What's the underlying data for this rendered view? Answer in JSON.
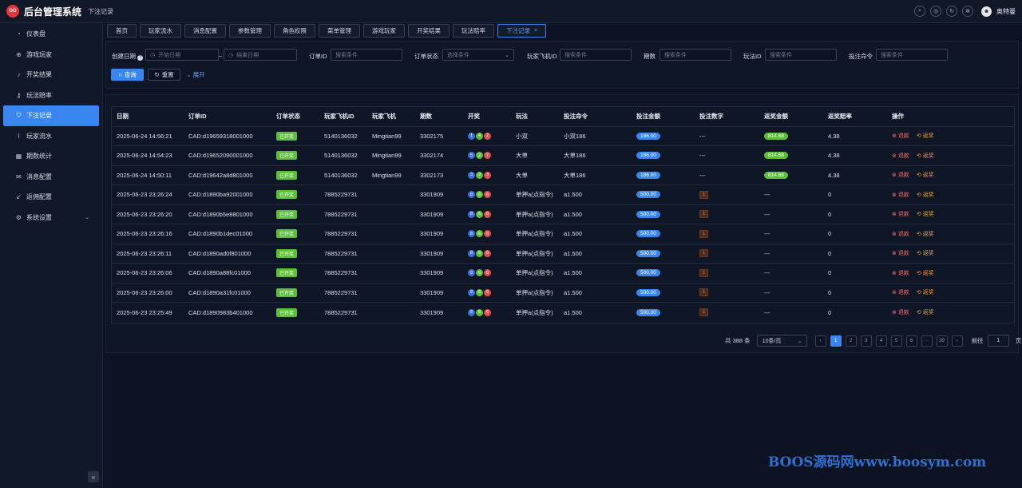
{
  "header": {
    "logo_text": "GO",
    "app_title": "后台管理系统",
    "breadcrumb": "下注记录",
    "username": "奥特曼"
  },
  "sidebar": {
    "items": [
      {
        "label": "仪表盘",
        "icon": "dashboard-icon"
      },
      {
        "label": "游戏玩家",
        "icon": "globe-icon"
      },
      {
        "label": "开奖结果",
        "icon": "bell-icon"
      },
      {
        "label": "玩法赔率",
        "icon": "key-icon"
      },
      {
        "label": "下注记录",
        "icon": "shield-icon",
        "active": true
      },
      {
        "label": "玩家流水",
        "icon": "trend-icon"
      },
      {
        "label": "期数统计",
        "icon": "calendar-icon"
      },
      {
        "label": "消息配置",
        "icon": "message-icon"
      },
      {
        "label": "返佣配置",
        "icon": "arrow-icon"
      },
      {
        "label": "系统设置",
        "icon": "settings-icon",
        "has_children": true
      }
    ],
    "collapse_label": "«"
  },
  "tabs": [
    {
      "label": "首页"
    },
    {
      "label": "玩家流水"
    },
    {
      "label": "消息配置"
    },
    {
      "label": "参数管理"
    },
    {
      "label": "角色权限"
    },
    {
      "label": "菜单管理"
    },
    {
      "label": "游戏玩家"
    },
    {
      "label": "开奖结果"
    },
    {
      "label": "玩法赔率"
    },
    {
      "label": "下注记录",
      "active": true,
      "close": "×"
    }
  ],
  "filters": {
    "create_date_label": "创建日期",
    "start_date_placeholder": "开始日期",
    "date_sep": "–",
    "end_date_placeholder": "结束日期",
    "order_id_label": "订单ID",
    "order_id_placeholder": "搜索条件",
    "order_status_label": "订单状态",
    "order_status_placeholder": "选择条件",
    "player_fid_label": "玩家飞机ID",
    "player_fid_placeholder": "搜索条件",
    "period_label": "期数",
    "period_placeholder": "搜索条件",
    "play_id_label": "玩法ID",
    "play_id_placeholder": "搜索条件",
    "bet_cmd_label": "投注命令",
    "bet_cmd_placeholder": "搜索条件",
    "search_btn": "查询",
    "reset_btn": "重置",
    "expand_btn": "展开"
  },
  "table": {
    "columns": [
      "日期",
      "订单ID",
      "订单状态",
      "玩家飞机ID",
      "玩家飞机",
      "期数",
      "开奖",
      "玩法",
      "投注命令",
      "投注金额",
      "投注数字",
      "返奖金额",
      "返奖赔率",
      "操作"
    ],
    "rows": [
      {
        "date": "2025-06-24 14:56:21",
        "order_id": "CAD:d19659318001000",
        "status": "已开奖",
        "fid": "5140136032",
        "fname": "Mingtian99",
        "period": "3302175",
        "balls": [
          {
            "n": "1",
            "c": "#3a6fe0"
          },
          {
            "n": "4",
            "c": "#5cbf3a"
          },
          {
            "n": "2",
            "c": "#e05050"
          }
        ],
        "play": "小双",
        "cmd": "小双186",
        "amount": "186.00",
        "digit": "---",
        "reward": "814.68",
        "odds": "4.38",
        "op_refund": "退款",
        "op_reward": "返奖"
      },
      {
        "date": "2025-06-24 14:54:23",
        "order_id": "CAD:d19652090001000",
        "status": "已开奖",
        "fid": "5140136032",
        "fname": "Mingtian99",
        "period": "3302174",
        "balls": [
          {
            "n": "5",
            "c": "#3a6fe0"
          },
          {
            "n": "2",
            "c": "#5cbf3a"
          },
          {
            "n": "7",
            "c": "#e05050"
          }
        ],
        "play": "大单",
        "cmd": "大单186",
        "amount": "186.00",
        "digit": "---",
        "reward": "814.68",
        "odds": "4.38",
        "op_refund": "退款",
        "op_reward": "返奖"
      },
      {
        "date": "2025-06-24 14:50:11",
        "order_id": "CAD:d19642a8d801000",
        "status": "已开奖",
        "fid": "5140136032",
        "fname": "Mingtian99",
        "period": "3302173",
        "balls": [
          {
            "n": "3",
            "c": "#3a6fe0"
          },
          {
            "n": "9",
            "c": "#5cbf3a"
          },
          {
            "n": "3",
            "c": "#e05050"
          }
        ],
        "play": "大单",
        "cmd": "大单186",
        "amount": "186.00",
        "digit": "---",
        "reward": "814.68",
        "odds": "4.38",
        "op_refund": "退款",
        "op_reward": "返奖"
      },
      {
        "date": "2025-06-23 23:26:24",
        "order_id": "CAD:d1890ba92001000",
        "status": "已开奖",
        "fid": "7885229731",
        "fname": "",
        "period": "3301909",
        "balls": [
          {
            "n": "8",
            "c": "#3a6fe0"
          },
          {
            "n": "6",
            "c": "#5cbf3a"
          },
          {
            "n": "6",
            "c": "#e05050"
          }
        ],
        "play": "单押a(点指令)",
        "cmd": "a1.500",
        "amount": "500.00",
        "digit": "1",
        "reward": "---",
        "odds": "0",
        "op_refund": "退款",
        "op_reward": "返奖"
      },
      {
        "date": "2025-06-23 23:26:20",
        "order_id": "CAD:d1890b5e8801000",
        "status": "已开奖",
        "fid": "7885229731",
        "fname": "",
        "period": "3301909",
        "balls": [
          {
            "n": "8",
            "c": "#3a6fe0"
          },
          {
            "n": "6",
            "c": "#5cbf3a"
          },
          {
            "n": "6",
            "c": "#e05050"
          }
        ],
        "play": "单押a(点指令)",
        "cmd": "a1.500",
        "amount": "500.00",
        "digit": "1",
        "reward": "---",
        "odds": "0",
        "op_refund": "退款",
        "op_reward": "返奖"
      },
      {
        "date": "2025-06-23 23:26:16",
        "order_id": "CAD:d1890b1dec01000",
        "status": "已开奖",
        "fid": "7885229731",
        "fname": "",
        "period": "3301909",
        "balls": [
          {
            "n": "8",
            "c": "#3a6fe0"
          },
          {
            "n": "6",
            "c": "#5cbf3a"
          },
          {
            "n": "6",
            "c": "#e05050"
          }
        ],
        "play": "单押a(点指令)",
        "cmd": "a1.500",
        "amount": "500.00",
        "digit": "1",
        "reward": "---",
        "odds": "0",
        "op_refund": "退款",
        "op_reward": "返奖"
      },
      {
        "date": "2025-06-23 23:26:11",
        "order_id": "CAD:d1890ad0f801000",
        "status": "已开奖",
        "fid": "7885229731",
        "fname": "",
        "period": "3301909",
        "balls": [
          {
            "n": "8",
            "c": "#3a6fe0"
          },
          {
            "n": "6",
            "c": "#5cbf3a"
          },
          {
            "n": "6",
            "c": "#e05050"
          }
        ],
        "play": "单押a(点指令)",
        "cmd": "a1.500",
        "amount": "500.00",
        "digit": "1",
        "reward": "---",
        "odds": "0",
        "op_refund": "退款",
        "op_reward": "返奖"
      },
      {
        "date": "2025-06-23 23:26:06",
        "order_id": "CAD:d1890a88fc01000",
        "status": "已开奖",
        "fid": "7885229731",
        "fname": "",
        "period": "3301909",
        "balls": [
          {
            "n": "8",
            "c": "#3a6fe0"
          },
          {
            "n": "6",
            "c": "#5cbf3a"
          },
          {
            "n": "6",
            "c": "#e05050"
          }
        ],
        "play": "单押a(点指令)",
        "cmd": "a1.500",
        "amount": "500.00",
        "digit": "1",
        "reward": "---",
        "odds": "0",
        "op_refund": "退款",
        "op_reward": "返奖"
      },
      {
        "date": "2025-06-23 23:26:00",
        "order_id": "CAD:d1890a31fc01000",
        "status": "已开奖",
        "fid": "7885229731",
        "fname": "",
        "period": "3301909",
        "balls": [
          {
            "n": "8",
            "c": "#3a6fe0"
          },
          {
            "n": "6",
            "c": "#5cbf3a"
          },
          {
            "n": "6",
            "c": "#e05050"
          }
        ],
        "play": "单押a(点指令)",
        "cmd": "a1.500",
        "amount": "500.00",
        "digit": "1",
        "reward": "---",
        "odds": "0",
        "op_refund": "退款",
        "op_reward": "返奖"
      },
      {
        "date": "2025-06-23 23:25:49",
        "order_id": "CAD:d1890983b401000",
        "status": "已开奖",
        "fid": "7885229731",
        "fname": "",
        "period": "3301909",
        "balls": [
          {
            "n": "8",
            "c": "#3a6fe0"
          },
          {
            "n": "6",
            "c": "#5cbf3a"
          },
          {
            "n": "6",
            "c": "#e05050"
          }
        ],
        "play": "单押a(点指令)",
        "cmd": "a1.500",
        "amount": "500.00",
        "digit": "1",
        "reward": "---",
        "odds": "0",
        "op_refund": "退款",
        "op_reward": "返奖"
      }
    ]
  },
  "pagination": {
    "total_text": "共 388 条",
    "page_size": "10条/页",
    "prev": "‹",
    "pages": [
      "1",
      "2",
      "3",
      "4",
      "5",
      "6",
      "···",
      "39"
    ],
    "active_page": "1",
    "next": "›",
    "goto_label": "前往",
    "goto_value": "1",
    "page_suffix": "页"
  },
  "watermark": "BOOS源码网www.boosym.com"
}
